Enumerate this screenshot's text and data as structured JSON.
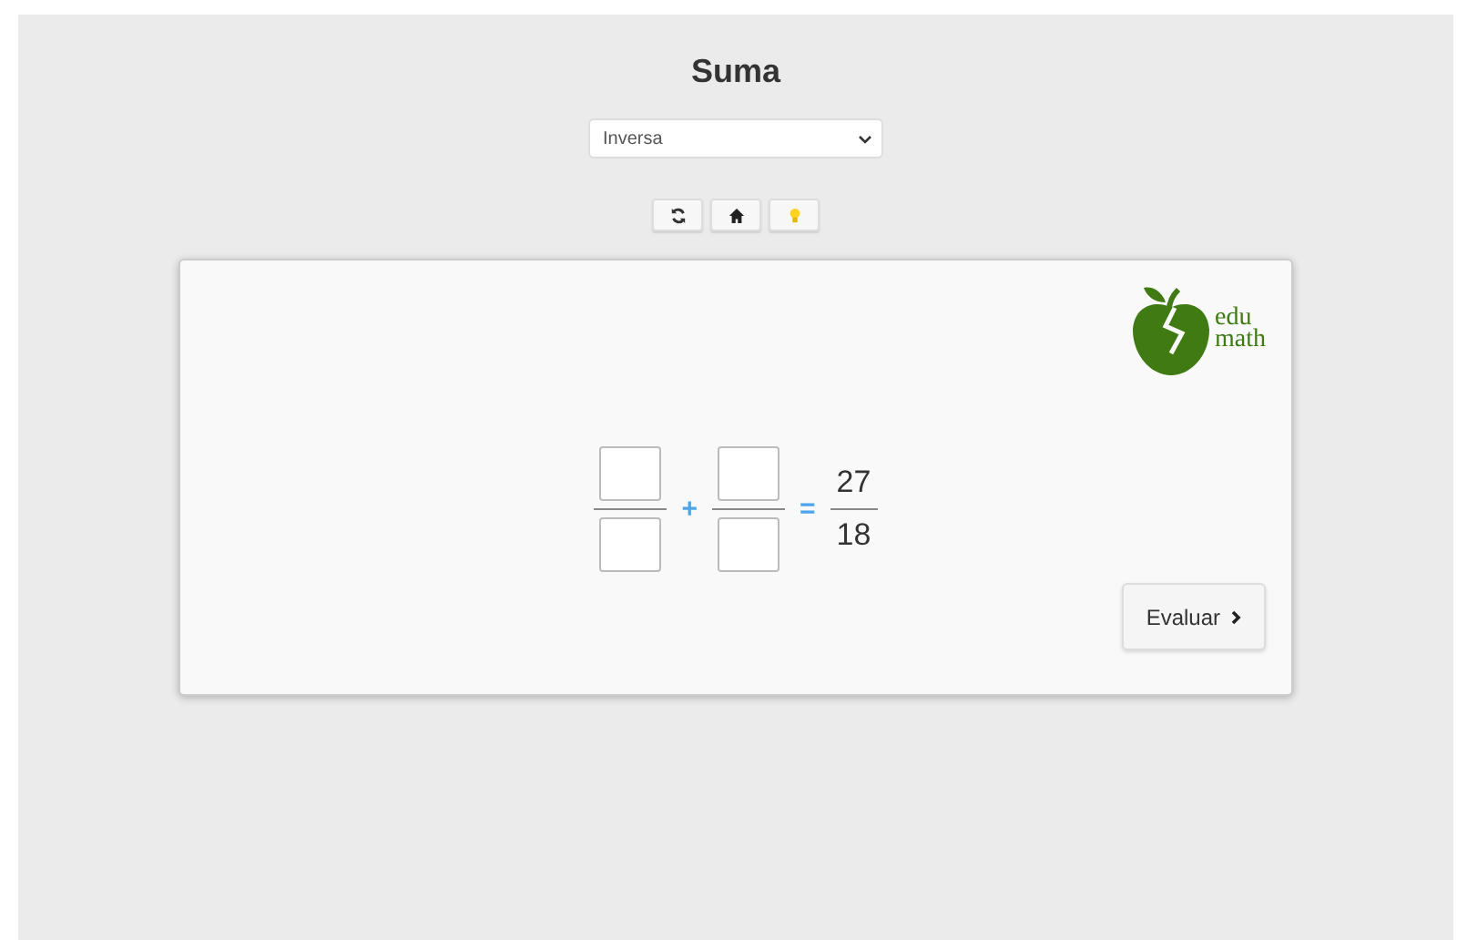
{
  "title": "Suma",
  "mode_select": {
    "value": "Inversa"
  },
  "toolbar": [
    {
      "kind": "refresh"
    },
    {
      "kind": "home"
    },
    {
      "kind": "hint"
    }
  ],
  "logo": {
    "line_1": "edu",
    "line_2": "math"
  },
  "equation": {
    "operator": "+",
    "equals": "=",
    "result": {
      "numerator": "27",
      "denominator": "18"
    }
  },
  "evaluate_button": {
    "label": "Evaluar"
  }
}
